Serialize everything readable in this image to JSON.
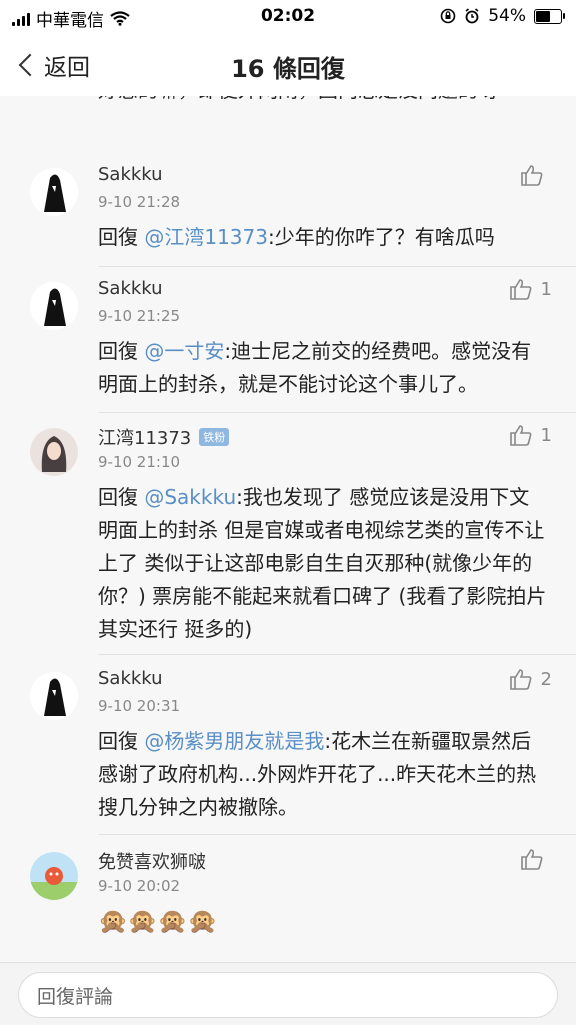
{
  "status_bar": {
    "carrier": "中華電信",
    "time": "02:02",
    "battery": "54%",
    "battery_level": 0.54
  },
  "nav": {
    "back_label": "返回",
    "title": "16 條回復"
  },
  "partial_text": "好感的嘛，即便外网闹，国内总是没问题的呀",
  "comments": [
    {
      "name": "Sakkku",
      "time": "9-10 21:28",
      "reply_prefix": "回復 ",
      "mention": "@江湾11373",
      "text": ":少年的你咋了？有啥瓜吗",
      "likes": ""
    },
    {
      "name": "Sakkku",
      "time": "9-10 21:25",
      "reply_prefix": "回復 ",
      "mention": "@一寸安",
      "text": ":迪士尼之前交的经费吧。感觉没有明面上的封杀，就是不能讨论这个事儿了。",
      "likes": "1"
    },
    {
      "name": "江湾11373",
      "badge": "铁粉",
      "time": "9-10 21:10",
      "reply_prefix": "回復 ",
      "mention": "@Sakkku",
      "text": ":我也发现了 感觉应该是没用下文明面上的封杀 但是官媒或者电视综艺类的宣传不让上了 类似于让这部电影自生自灭那种(就像少年的你？) 票房能不能起来就看口碑了 (我看了影院拍片其实还行 挺多的)",
      "likes": "1"
    },
    {
      "name": "Sakkku",
      "time": "9-10 20:31",
      "reply_prefix": "回復 ",
      "mention": "@杨紫男朋友就是我",
      "text": ":花木兰在新疆取景然后感谢了政府机构...外网炸开花了...昨天花木兰的热搜几分钟之内被撤除。",
      "likes": "2"
    },
    {
      "name": "免赞喜欢狮啵",
      "time": "9-10 20:02",
      "text": "🙊🙊🙊🙊",
      "likes": ""
    }
  ],
  "reply_box": {
    "placeholder": "回復評論"
  }
}
